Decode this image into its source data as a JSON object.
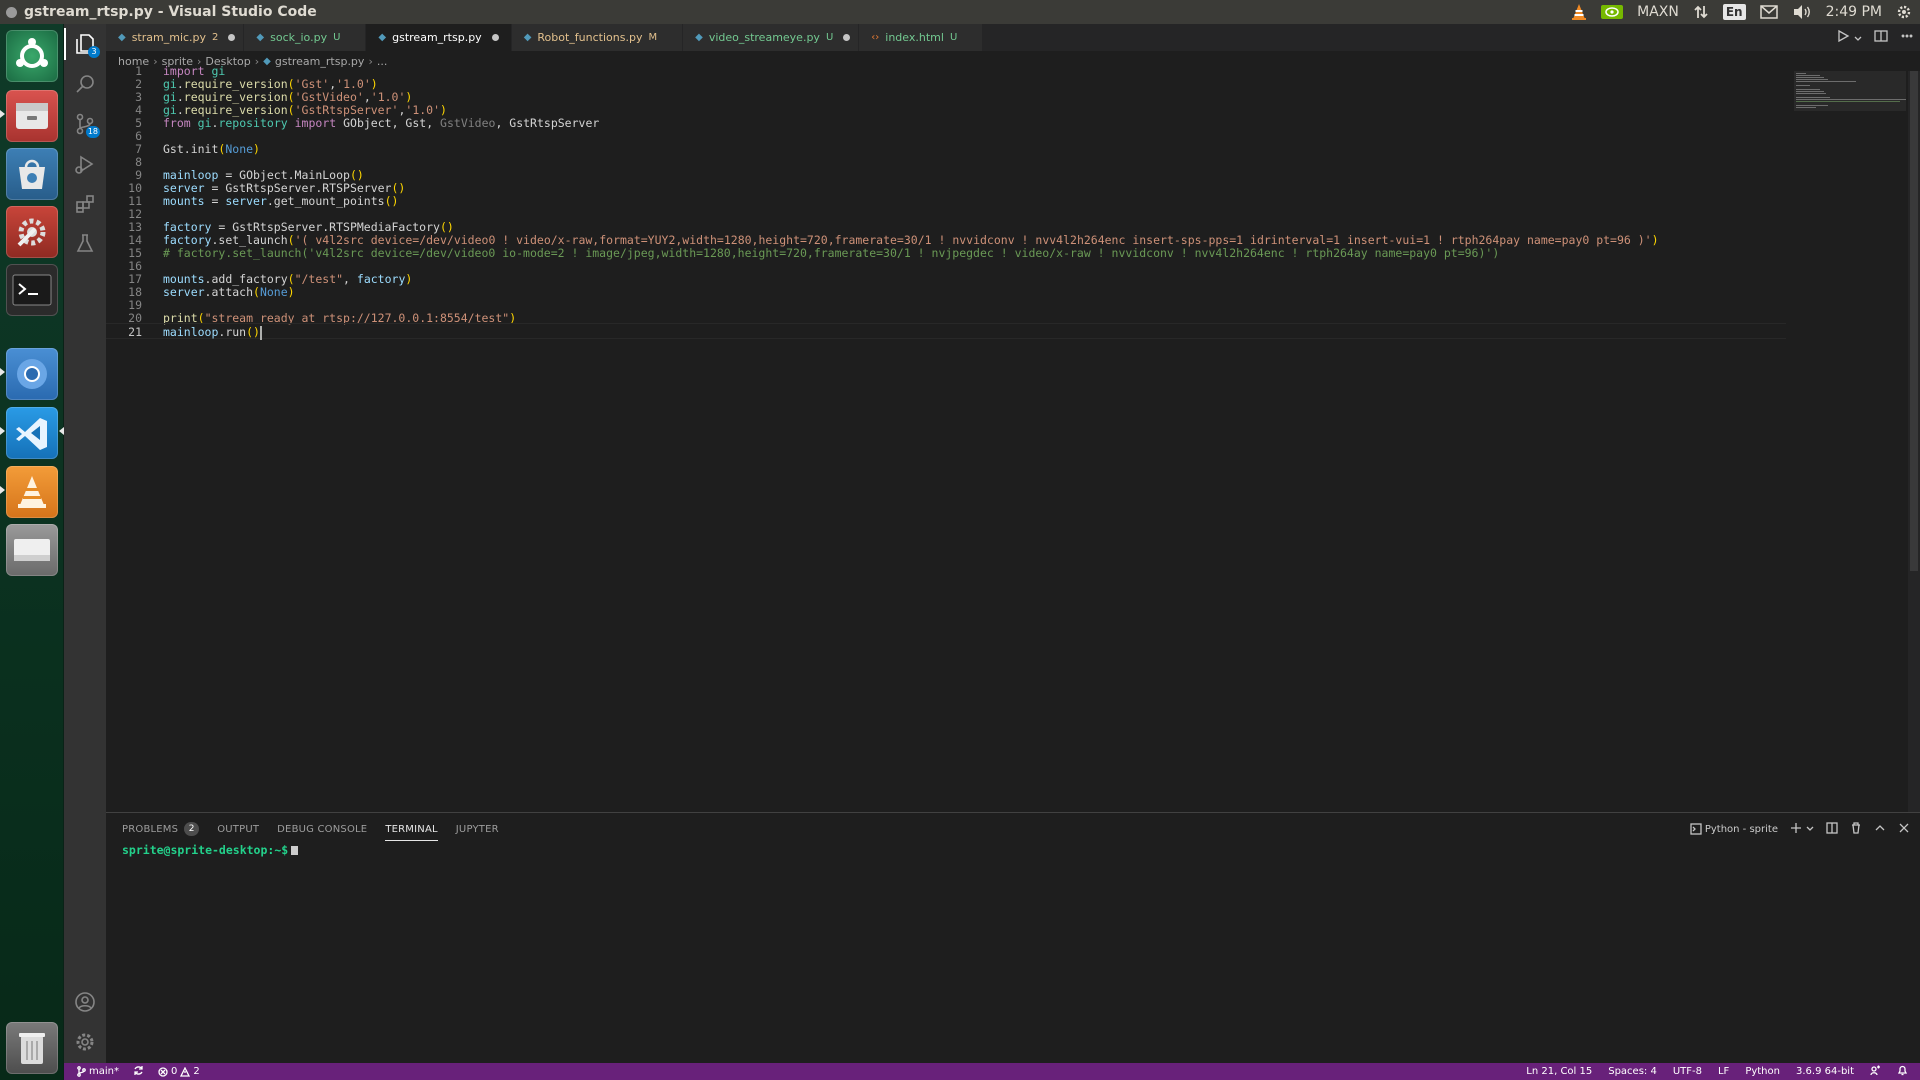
{
  "window": {
    "title": "gstream_rtsp.py - Visual Studio Code"
  },
  "topbar": {
    "power_mode": "MAXN",
    "language": "En",
    "time": "2:49 PM"
  },
  "launcher": {
    "apps": [
      "ubuntu-dash",
      "file-manager",
      "software-center",
      "system-settings",
      "terminal",
      "chromium",
      "vscode",
      "vlc",
      "drive"
    ],
    "trash": "trash"
  },
  "activity": {
    "explorer_badge": "3",
    "scm_badge": "18"
  },
  "tabs": [
    {
      "name": "stram_mic.py",
      "status": "2",
      "dirty": true,
      "active": false
    },
    {
      "name": "sock_io.py",
      "status": "U",
      "dirty": false,
      "active": false
    },
    {
      "name": "gstream_rtsp.py",
      "status": "",
      "dirty": true,
      "active": true
    },
    {
      "name": "Robot_functions.py",
      "status": "M",
      "dirty": false,
      "active": false
    },
    {
      "name": "video_streameye.py",
      "status": "U",
      "dirty": true,
      "active": false
    },
    {
      "name": "index.html",
      "status": "U",
      "dirty": false,
      "active": false
    }
  ],
  "breadcrumb": [
    "home",
    "sprite",
    "Desktop",
    "gstream_rtsp.py",
    "..."
  ],
  "code": {
    "current_line": 21,
    "l5_import": "GObject, Gst, ",
    "l5_unused": "GstVideo",
    "l5_last": ", GstRtspServer",
    "l14_arg": "'( v4l2src device=/dev/video0 ! video/x-raw,format=YUY2,width=1280,height=720,framerate=30/1 ! nvvidconv ! nvv4l2h264enc insert-sps-pps=1 idrinterval=1 insert-vui=1 ! rtph264pay name=pay0 pt=96 )'",
    "l15_comment": "# factory.set_launch('v4l2src device=/dev/video0 io-mode=2 ! image/jpeg,width=1280,height=720,framerate=30/1 ! nvjpegdec ! video/x-raw ! nvvidconv ! nvv4l2h264enc ! rtph264ay name=pay0 pt=96)')",
    "l20_string": "\"stream ready at rtsp://127.0.0.1:8554/test\""
  },
  "panel": {
    "tabs": [
      {
        "label": "PROBLEMS",
        "badge": "2",
        "active": false
      },
      {
        "label": "OUTPUT",
        "badge": "",
        "active": false
      },
      {
        "label": "DEBUG CONSOLE",
        "badge": "",
        "active": false
      },
      {
        "label": "TERMINAL",
        "badge": "",
        "active": true
      },
      {
        "label": "JUPYTER",
        "badge": "",
        "active": false
      }
    ],
    "terminal_name": "Python - sprite",
    "terminal_prompt": "sprite@sprite-desktop:~$"
  },
  "statusbar": {
    "branch": "main*",
    "errors": "0",
    "warnings": "2",
    "position": "Ln 21, Col 15",
    "spaces": "Spaces: 4",
    "encoding": "UTF-8",
    "eol": "LF",
    "language": "Python",
    "interpreter": "3.6.9 64-bit"
  },
  "colors": {
    "statusbar": "#68217a",
    "accent": "#007acc",
    "launcher": "#0f3a28"
  }
}
